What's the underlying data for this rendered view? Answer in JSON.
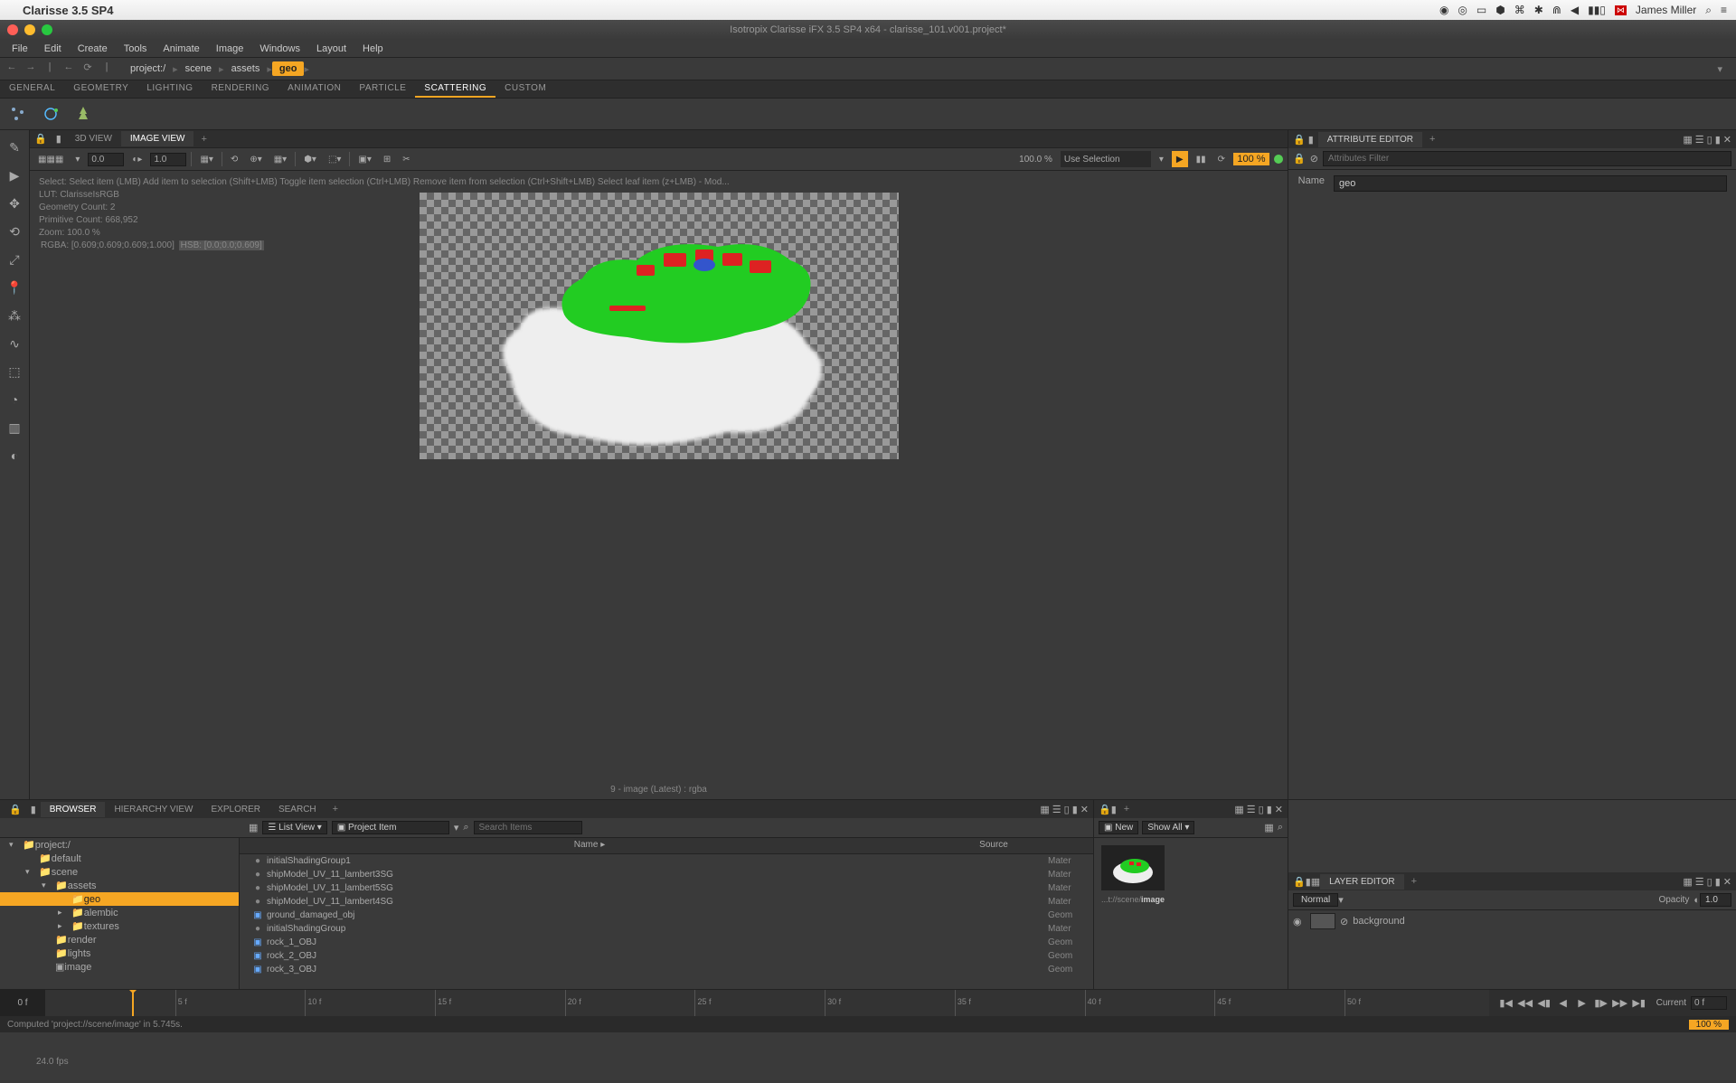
{
  "mac": {
    "app_name": "Clarisse 3.5 SP4",
    "user": "James Miller",
    "flag": "EN"
  },
  "window": {
    "title": "Isotropix Clarisse iFX 3.5 SP4 x64 - clarisse_101.v001.project*"
  },
  "menu": [
    "File",
    "Edit",
    "Create",
    "Tools",
    "Animate",
    "Image",
    "Windows",
    "Layout",
    "Help"
  ],
  "breadcrumb": [
    "project:/",
    "scene",
    "assets",
    "geo"
  ],
  "shelf_tabs": [
    "GENERAL",
    "GEOMETRY",
    "LIGHTING",
    "RENDERING",
    "ANIMATION",
    "PARTICLE",
    "SCATTERING",
    "CUSTOM"
  ],
  "active_shelf": "SCATTERING",
  "view_tabs": [
    "3D VIEW",
    "IMAGE VIEW"
  ],
  "active_view": "IMAGE VIEW",
  "view_toolbar": {
    "val1": "0.0",
    "val2": "1.0",
    "zoom_pct": "100.0 %",
    "selection_mode": "Use Selection",
    "progress": "100 %"
  },
  "viewport_hints": {
    "select": "Select: Select item (LMB)  Add item to selection (Shift+LMB)  Toggle item selection (Ctrl+LMB)  Remove item from selection (Ctrl+Shift+LMB)  Select leaf item (z+LMB)  - Mod...",
    "lut": "LUT: ClarisseIsRGB",
    "geom": "Geometry Count: 2",
    "prim": "Primitive Count: 668,952",
    "zoom": "Zoom: 100.0 %",
    "rgba": "RGBA: [0.609;0.609;0.609;1.000]",
    "hsb": "HSB: [0.0;0.0;0.609]"
  },
  "viewport_status": "9 - image (Latest) : rgba",
  "browser": {
    "tabs": [
      "BROWSER",
      "HIERARCHY VIEW",
      "EXPLORER",
      "SEARCH"
    ],
    "active": "BROWSER",
    "view_mode": "List View",
    "filter": "Project Item",
    "search_ph": "Search Items",
    "tree": [
      {
        "label": "project:/",
        "indent": 0,
        "expanded": true,
        "folder": true
      },
      {
        "label": "default",
        "indent": 1,
        "folder": true
      },
      {
        "label": "scene",
        "indent": 1,
        "expanded": true,
        "folder": true
      },
      {
        "label": "assets",
        "indent": 2,
        "expanded": true,
        "folder": true
      },
      {
        "label": "geo",
        "indent": 3,
        "folder": true,
        "selected": true
      },
      {
        "label": "alembic",
        "indent": 3,
        "folder": true,
        "has_children": true
      },
      {
        "label": "textures",
        "indent": 3,
        "folder": true,
        "has_children": true
      },
      {
        "label": "render",
        "indent": 2,
        "folder": true
      },
      {
        "label": "lights",
        "indent": 2,
        "folder": true
      },
      {
        "label": "image",
        "indent": 2,
        "file": true
      }
    ],
    "columns": {
      "name": "Name ▸",
      "source": "Source"
    },
    "items": [
      {
        "name": "initialShadingGroup1",
        "type": "Mater",
        "icon": "mat"
      },
      {
        "name": "shipModel_UV_11_lambert3SG",
        "type": "Mater",
        "icon": "mat"
      },
      {
        "name": "shipModel_UV_11_lambert5SG",
        "type": "Mater",
        "icon": "mat"
      },
      {
        "name": "shipModel_UV_11_lambert4SG",
        "type": "Mater",
        "icon": "mat"
      },
      {
        "name": "ground_damaged_obj",
        "type": "Geom",
        "icon": "geom"
      },
      {
        "name": "initialShadingGroup",
        "type": "Mater",
        "icon": "mat"
      },
      {
        "name": "rock_1_OBJ",
        "type": "Geom",
        "icon": "geom"
      },
      {
        "name": "rock_2_OBJ",
        "type": "Geom",
        "icon": "geom"
      },
      {
        "name": "rock_3_OBJ",
        "type": "Geom",
        "icon": "geom"
      }
    ]
  },
  "thumb": {
    "new_label": "New",
    "show_label": "Show All",
    "path_prefix": "...t://scene/",
    "path_bold": "image"
  },
  "attr": {
    "title": "ATTRIBUTE EDITOR",
    "filter_ph": "Attributes Filter",
    "name_label": "Name",
    "name_value": "geo"
  },
  "layer": {
    "title": "LAYER EDITOR",
    "blend": "Normal",
    "opacity_label": "Opacity",
    "opacity_value": "1.0",
    "layers": [
      {
        "name": "background"
      }
    ]
  },
  "timeline": {
    "start": "0 f",
    "marks": [
      "5 f",
      "10 f",
      "15 f",
      "20 f",
      "25 f",
      "30 f",
      "35 f",
      "40 f",
      "45 f",
      "50 f"
    ],
    "current_label": "Current",
    "current_value": "0 f",
    "fps": "24.0 fps"
  },
  "status": {
    "message": "Computed 'project://scene/image' in 5.745s.",
    "progress": "100 %"
  }
}
